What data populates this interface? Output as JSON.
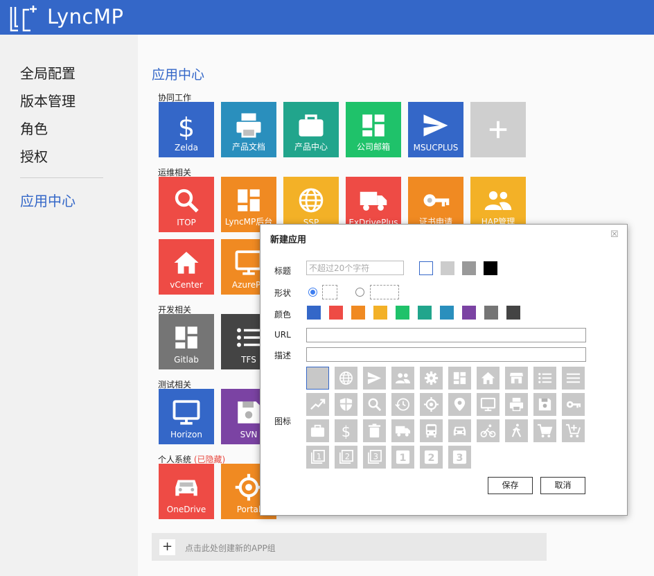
{
  "header": {
    "brand": "LyncMP"
  },
  "sidebar": {
    "items": [
      {
        "label": "全局配置"
      },
      {
        "label": "版本管理"
      },
      {
        "label": "角色"
      },
      {
        "label": "授权"
      }
    ],
    "active": {
      "label": "应用中心"
    }
  },
  "main": {
    "title": "应用中心",
    "groups": [
      {
        "label": "协同工作",
        "tiles": [
          {
            "label": "Zelda",
            "icon": "dollar-icon",
            "color": "#3467c8"
          },
          {
            "label": "产品文档",
            "icon": "printer-icon",
            "color": "#2a8fbd"
          },
          {
            "label": "产品中心",
            "icon": "briefcase-icon",
            "color": "#21a58c"
          },
          {
            "label": "公司邮箱",
            "icon": "dashboard-icon",
            "color": "#1fc26a"
          },
          {
            "label": "MSUCPLUS",
            "icon": "send-icon",
            "color": "#3467c8"
          },
          {
            "label": "",
            "icon": "plus-icon",
            "color": "#cfcfcf"
          }
        ]
      },
      {
        "label": "运维相关",
        "tiles": [
          {
            "label": "ITOP",
            "icon": "search-icon",
            "color": "#ee4b45"
          },
          {
            "label": "LyncMP后台",
            "icon": "dashboard-icon",
            "color": "#f08a22"
          },
          {
            "label": "SSP",
            "icon": "globe-icon",
            "color": "#f3b127"
          },
          {
            "label": "ExDrivePlus",
            "icon": "truck-icon",
            "color": "#ee4b45"
          },
          {
            "label": "证书申请",
            "icon": "key-icon",
            "color": "#f08a22"
          },
          {
            "label": "HAP管理",
            "icon": "users-icon",
            "color": "#f3b127"
          },
          {
            "label": "vCenter",
            "icon": "home-icon",
            "color": "#ee4b45"
          },
          {
            "label": "AzurePa",
            "icon": "monitor-icon",
            "color": "#f08a22"
          }
        ]
      },
      {
        "label": "开发相关",
        "tiles": [
          {
            "label": "Gitlab",
            "icon": "dashboard-icon",
            "color": "#757575"
          },
          {
            "label": "TFS",
            "icon": "list-icon",
            "color": "#444444"
          }
        ]
      },
      {
        "label": "测试相关",
        "tiles": [
          {
            "label": "Horizon",
            "icon": "monitor-icon",
            "color": "#3467c8"
          },
          {
            "label": "SVN",
            "icon": "save-icon",
            "color": "#7b43a3"
          }
        ]
      },
      {
        "label": "个人系统",
        "hidden_tag": "(已隐藏)",
        "tiles": [
          {
            "label": "OneDrive",
            "icon": "car-icon",
            "color": "#ee4b45"
          },
          {
            "label": "Portal",
            "icon": "target-icon",
            "color": "#f08a22"
          }
        ]
      }
    ],
    "add_group_text": "点击此处创建新的APP组",
    "add_group_button": "+"
  },
  "dialog": {
    "title": "新建应用",
    "close": "☒",
    "labels": {
      "title": "标题",
      "shape": "形状",
      "color": "颜色",
      "url": "URL",
      "desc": "描述",
      "icon": "图标"
    },
    "title_placeholder": "不超过20个字符",
    "title_value": "",
    "title_swatches": [
      "#ffffff",
      "#cccccc",
      "#999999",
      "#000000"
    ],
    "colors": [
      "#3467c8",
      "#ee4b45",
      "#f08a22",
      "#f3b127",
      "#1fc26a",
      "#21a58c",
      "#2a8fbd",
      "#7b43a3",
      "#757575",
      "#444444"
    ],
    "url_value": "",
    "desc_value": "",
    "icons": [
      "blank-icon",
      "globe-icon",
      "send-icon",
      "users-icon",
      "gear-icon",
      "dashboard-icon",
      "home-icon",
      "store-icon",
      "list-icon",
      "menu-icon",
      "trend-icon",
      "shield-icon",
      "search-icon",
      "history-icon",
      "target-icon",
      "pin-icon",
      "monitor-icon",
      "printer-icon",
      "save-icon",
      "key-icon",
      "briefcase-icon",
      "dollar-icon",
      "trash-icon",
      "truck-icon",
      "bus-icon",
      "car-icon",
      "bike-icon",
      "walk-icon",
      "cart-icon",
      "cart-add-icon",
      "stack-1-icon",
      "stack-2-icon",
      "stack-3-icon",
      "digit-1-icon",
      "digit-2-icon",
      "digit-3-icon"
    ],
    "save_label": "保存",
    "cancel_label": "取消"
  }
}
